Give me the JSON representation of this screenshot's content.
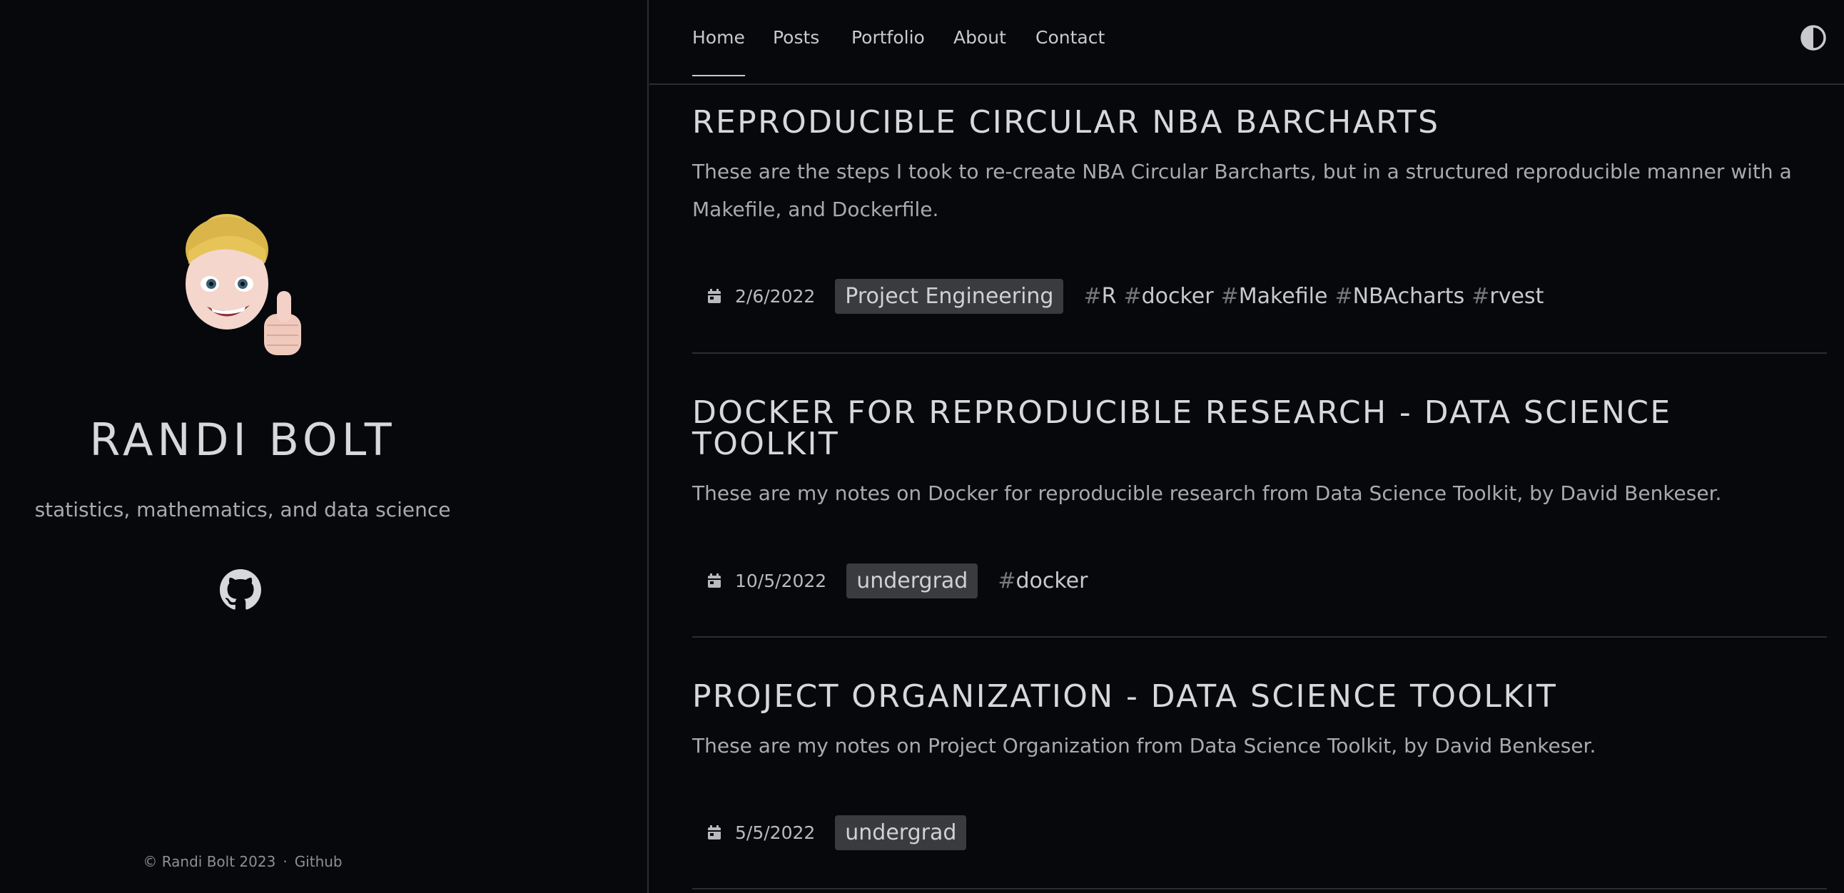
{
  "sidebar": {
    "site_name": "RANDI BOLT",
    "tagline": "statistics, mathematics, and data science",
    "github_icon": "github-icon",
    "footer": {
      "copyright": "© Randi Bolt 2023",
      "separator": "·",
      "github_link": "Github"
    }
  },
  "nav": {
    "items": [
      {
        "label": "Home",
        "active": true
      },
      {
        "label": "Posts"
      },
      {
        "label": "Portfolio"
      },
      {
        "label": "About"
      },
      {
        "label": "Contact"
      }
    ],
    "theme_toggle_icon": "contrast-icon"
  },
  "posts": [
    {
      "title": "REPRODUCIBLE CIRCULAR NBA BARCHARTS",
      "summary": "These are the steps I took to re-create NBA Circular Barcharts, but in a structured reproducible manner with a Makefile, and Dockerfile.",
      "date": "2/6/2022",
      "category": "Project Engineering",
      "tags": [
        "R",
        "docker",
        "Makefile",
        "NBAcharts",
        "rvest"
      ]
    },
    {
      "title": "DOCKER FOR REPRODUCIBLE RESEARCH - DATA SCIENCE TOOLKIT",
      "summary": "These are my notes on Docker for reproducible research from Data Science Toolkit, by David Benkeser.",
      "date": "10/5/2022",
      "category": "undergrad",
      "tags": [
        "docker"
      ]
    },
    {
      "title": "PROJECT ORGANIZATION - DATA SCIENCE TOOLKIT",
      "summary": "These are my notes on Project Organization from Data Science Toolkit, by David Benkeser.",
      "date": "5/5/2022",
      "category": "undergrad",
      "tags": []
    }
  ],
  "colors": {
    "background": "#06080c",
    "text": "#c9c9cc",
    "chip": "#3a3b3f",
    "divider": "#2c2d31"
  }
}
